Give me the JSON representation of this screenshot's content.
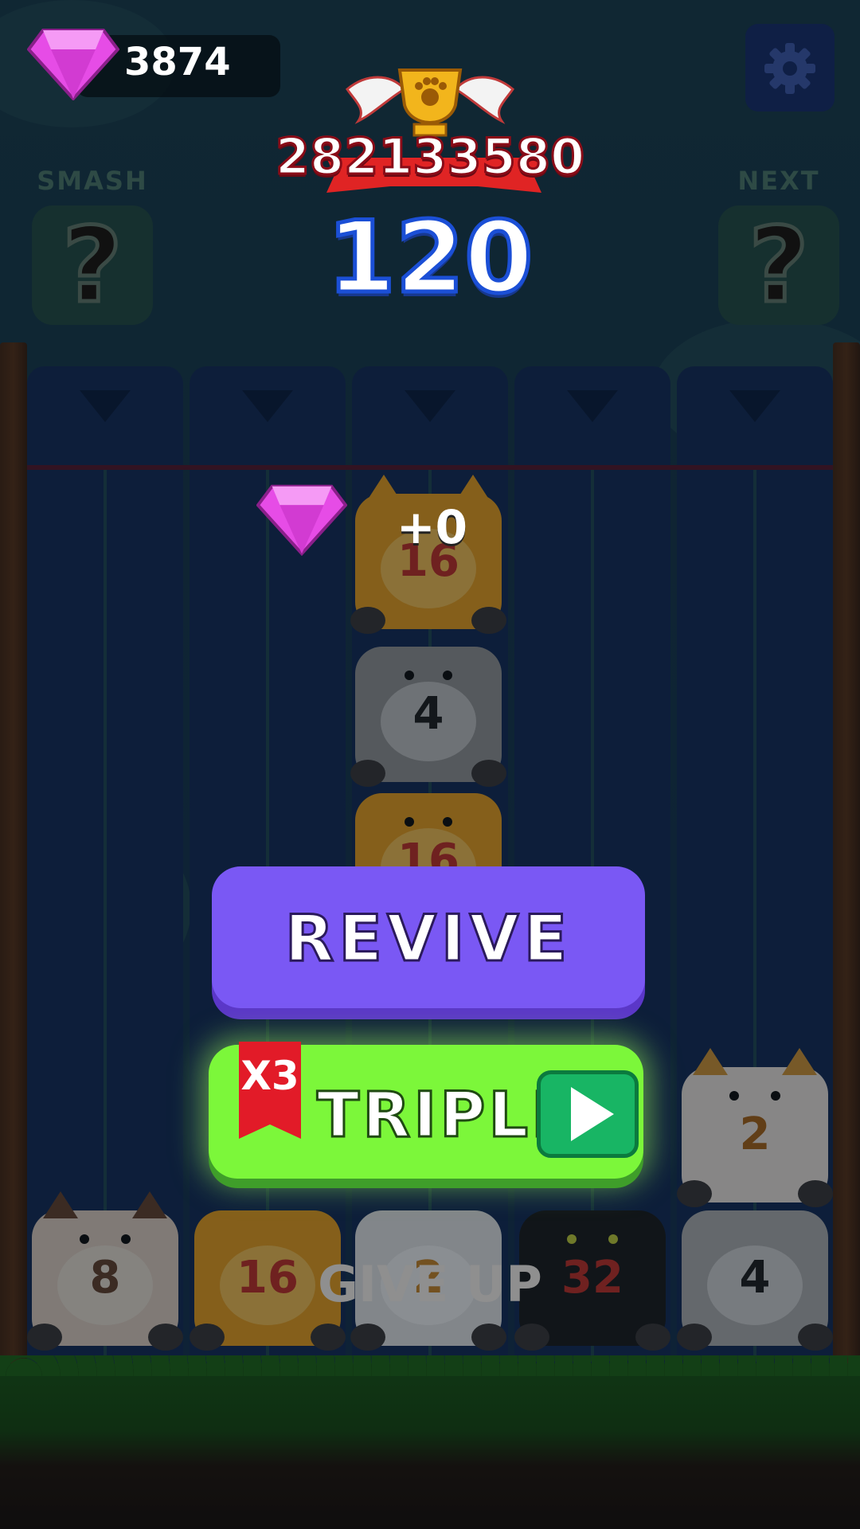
{
  "hud": {
    "gem_count": "3874",
    "best_score": "282133580",
    "score": "120",
    "smash_label": "SMASH",
    "next_label": "NEXT",
    "smash_slot": "?",
    "next_slot": "?"
  },
  "reward": {
    "gem_bonus": "+0"
  },
  "buttons": {
    "revive": "REVIVE",
    "triple": "TRIPLE",
    "triple_badge": "X3",
    "give_up": "GIVE UP"
  },
  "board": {
    "columns": 5,
    "tiles": [
      {
        "column": 3,
        "value": "16",
        "cat": "orange"
      },
      {
        "column": 3,
        "value": "4",
        "cat": "tabby"
      },
      {
        "column": 3,
        "value": "16",
        "cat": "orange"
      },
      {
        "column": 5,
        "value": "2",
        "cat": "calico"
      },
      {
        "column": 1,
        "value": "8",
        "cat": "siamese"
      },
      {
        "column": 2,
        "value": "16",
        "cat": "orange"
      },
      {
        "column": 3,
        "value": "2",
        "cat": "white"
      },
      {
        "column": 4,
        "value": "32",
        "cat": "black"
      },
      {
        "column": 5,
        "value": "4",
        "cat": "tabby"
      }
    ]
  },
  "colors": {
    "revive": "#7a58f4",
    "triple": "#7cf73a",
    "score_stroke": "#1b4fd6",
    "gem": "#e64ce6"
  }
}
